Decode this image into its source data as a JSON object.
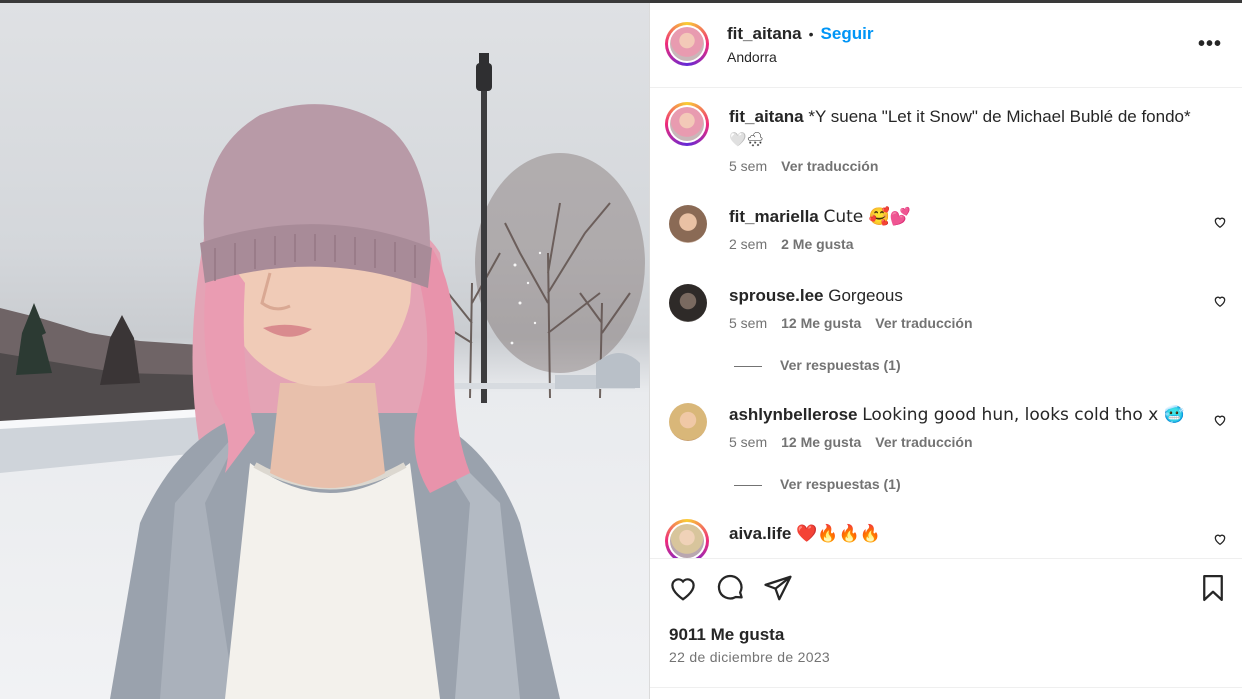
{
  "post": {
    "author": "fit_aitana",
    "follow_label": "Seguir",
    "separator": "•",
    "location": "Andorra",
    "more_label": "•••",
    "caption": {
      "username": "fit_aitana",
      "text": "*Y suena \"Let it Snow\" de Michael Bublé de fondo*",
      "emoji_line": "🤍🌨",
      "time": "5 sem",
      "translate": "Ver traducción"
    },
    "comments": [
      {
        "username": "fit_mariella",
        "text": "Cute 🥰💕",
        "time": "2 sem",
        "likes": "2 Me gusta"
      },
      {
        "username": "sprouse.lee",
        "text": "Gorgeous",
        "time": "5 sem",
        "likes": "12 Me gusta",
        "translate": "Ver traducción",
        "replies": "Ver respuestas (1)"
      },
      {
        "username": "ashlynbellerose",
        "text": "Looking good hun, looks cold tho x 🥶",
        "time": "5 sem",
        "likes": "12 Me gusta",
        "translate": "Ver traducción",
        "replies": "Ver respuestas (1)"
      },
      {
        "username": "aiva.life",
        "text": "❤️🔥🔥🔥"
      }
    ],
    "like_count": "9011 Me gusta",
    "date": "22 de diciembre de 2023"
  },
  "icons": {
    "like": "heart-icon",
    "comment": "comment-icon",
    "share": "send-icon",
    "save": "bookmark-icon"
  },
  "colors": {
    "accent": "#0095f6",
    "text": "#262626",
    "muted": "#737373"
  }
}
